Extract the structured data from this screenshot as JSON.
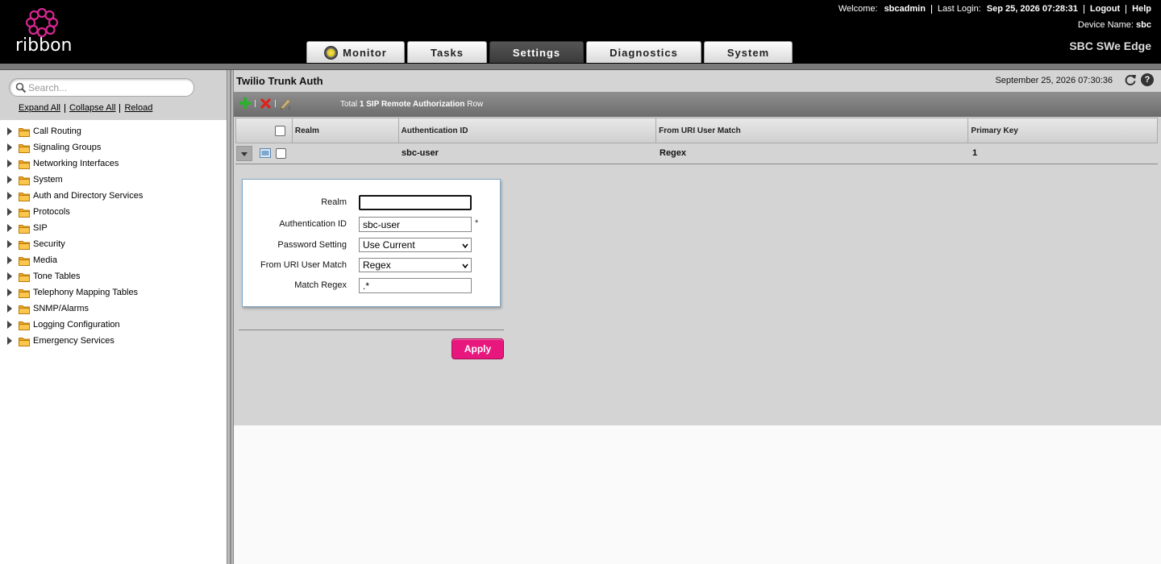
{
  "header": {
    "brand": "ribbon",
    "welcome_label": "Welcome:",
    "username": "sbcadmin",
    "last_login_label": "Last Login:",
    "last_login_value": "Sep 25, 2026 07:28:31",
    "logout_label": "Logout",
    "help_label": "Help",
    "device_name_label": "Device Name:",
    "device_name_value": "sbc",
    "product_name": "SBC SWe Edge",
    "tabs": [
      {
        "label": "Monitor"
      },
      {
        "label": "Tasks"
      },
      {
        "label": "Settings",
        "active": true
      },
      {
        "label": "Diagnostics"
      },
      {
        "label": "System"
      }
    ]
  },
  "sidebar": {
    "search_placeholder": "Search...",
    "expand_all": "Expand All",
    "collapse_all": "Collapse All",
    "reload": "Reload",
    "items": [
      {
        "label": "Call Routing"
      },
      {
        "label": "Signaling Groups"
      },
      {
        "label": "Networking Interfaces"
      },
      {
        "label": "System"
      },
      {
        "label": "Auth and Directory Services"
      },
      {
        "label": "Protocols"
      },
      {
        "label": "SIP"
      },
      {
        "label": "Security"
      },
      {
        "label": "Media"
      },
      {
        "label": "Tone Tables"
      },
      {
        "label": "Telephony Mapping Tables"
      },
      {
        "label": "SNMP/Alarms"
      },
      {
        "label": "Logging Configuration"
      },
      {
        "label": "Emergency Services"
      }
    ]
  },
  "main": {
    "title": "Twilio Trunk Auth",
    "date": "September 25, 2026 07:30:36",
    "toolbar": {
      "total_prefix": "Total",
      "total_bold": "1 SIP Remote Authorization",
      "total_suffix": "Row"
    },
    "grid": {
      "columns": [
        "Realm",
        "Authentication ID",
        "From URI User Match",
        "Primary Key"
      ],
      "rows": [
        {
          "realm": "",
          "authentication_id": "sbc-user",
          "from_uri_user_match": "Regex",
          "primary_key": "1"
        }
      ]
    },
    "form": {
      "realm_label": "Realm",
      "realm_value": "",
      "auth_id_label": "Authentication ID",
      "auth_id_value": "sbc-user",
      "required_marker": "*",
      "password_setting_label": "Password Setting",
      "password_setting_value": "Use Current",
      "from_uri_label": "From URI User Match",
      "from_uri_value": "Regex",
      "match_regex_label": "Match Regex",
      "match_regex_value": ".*"
    },
    "apply_label": "Apply"
  },
  "colors": {
    "brand_magenta": "#e8177d",
    "header_bg": "#000000",
    "panel_gray": "#d4d4d4"
  }
}
